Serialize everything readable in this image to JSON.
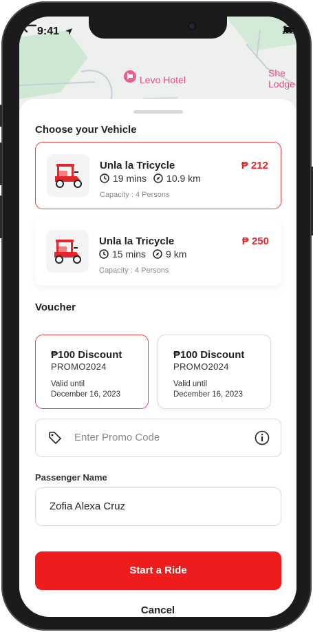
{
  "status": {
    "time": "9:41"
  },
  "map": {
    "hotel": "Levo Hotel",
    "lodge_line1": "She",
    "lodge_line2": "Lodge"
  },
  "vehicle_section": {
    "title": "Choose your Vehicle"
  },
  "vehicles": [
    {
      "name": "Unla la Tricycle",
      "time": "19 mins",
      "distance": "10.9 km",
      "capacity": "Capacity : 4 Persons",
      "price": "₱ 212",
      "selected": true
    },
    {
      "name": "Unla la Tricycle",
      "time": "15 mins",
      "distance": "9 km",
      "capacity": "Capacity : 4 Persons",
      "price": "₱ 250",
      "selected": false
    }
  ],
  "voucher_section": {
    "title": "Voucher"
  },
  "vouchers": [
    {
      "title": "₱100 Discount",
      "code": "PROMO2024",
      "valid_label": "Valid until",
      "valid_date": "December 16, 2023",
      "selected": true
    },
    {
      "title": "₱100 Discount",
      "code": "PROMO2024",
      "valid_label": "Valid until",
      "valid_date": "December 16, 2023",
      "selected": false
    }
  ],
  "promo": {
    "placeholder": "Enter Promo Code"
  },
  "passenger": {
    "label": "Passenger Name",
    "value": "Zofia Alexa Cruz"
  },
  "actions": {
    "start": "Start a Ride",
    "cancel": "Cancel"
  },
  "colors": {
    "accent": "#ee1c1c",
    "price": "#e8262b",
    "selected_border": "#ef3f3f",
    "map_label": "#e2507f"
  },
  "icons": [
    "back-arrow-icon",
    "clock-icon",
    "compass-icon",
    "tricycle-icon",
    "tag-icon",
    "info-icon",
    "signal-icon",
    "wifi-icon",
    "battery-icon",
    "location-arrow-icon",
    "hotel-pin-icon"
  ]
}
